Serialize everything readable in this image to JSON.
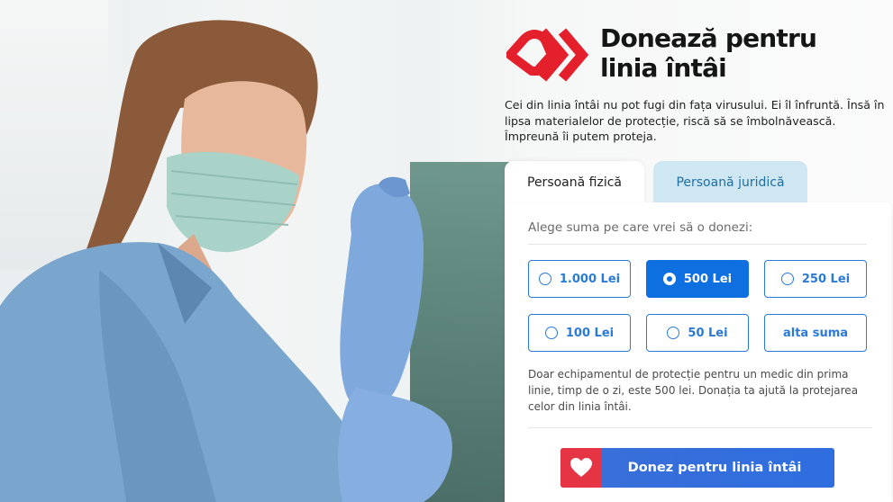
{
  "brand": {
    "title_line1": "Donează pentru",
    "title_line2": "linia întâi",
    "logo_icon": "heart-arrows-logo-icon",
    "logo_color": "#e3202c"
  },
  "intro_text": "Cei din linia întâi nu pot fugi din fața virusului. Ei îl înfruntă. Însă în lipsa materialelor de protecție, riscă să se îmbolnăvească. Împreună îi putem proteja.",
  "tabs": [
    {
      "label": "Persoană fizică",
      "active": true
    },
    {
      "label": "Persoană juridică",
      "active": false
    }
  ],
  "form": {
    "prompt": "Alege suma pe care vrei să o donezi:",
    "amounts": [
      {
        "label": "1.000 Lei",
        "selected": false,
        "has_radio": true
      },
      {
        "label": "500 Lei",
        "selected": true,
        "has_radio": true
      },
      {
        "label": "250 Lei",
        "selected": false,
        "has_radio": true
      },
      {
        "label": "100 Lei",
        "selected": false,
        "has_radio": true
      },
      {
        "label": "50 Lei",
        "selected": false,
        "has_radio": true
      },
      {
        "label": "alta suma",
        "selected": false,
        "has_radio": false
      }
    ],
    "info": "Doar echipamentul de protecție pentru un medic din prima linie, timp de o zi, este 500 lei. Donația ta ajută la protejarea celor din linia întâi.",
    "donate_button": "Donez pentru linia întâi",
    "donate_icon": "heart-icon"
  },
  "colors": {
    "accent_blue": "#2a7bd8",
    "selected_blue": "#0d6fe0",
    "tab_inactive_bg": "#cfe7f3",
    "heart_red": "#e53545"
  }
}
